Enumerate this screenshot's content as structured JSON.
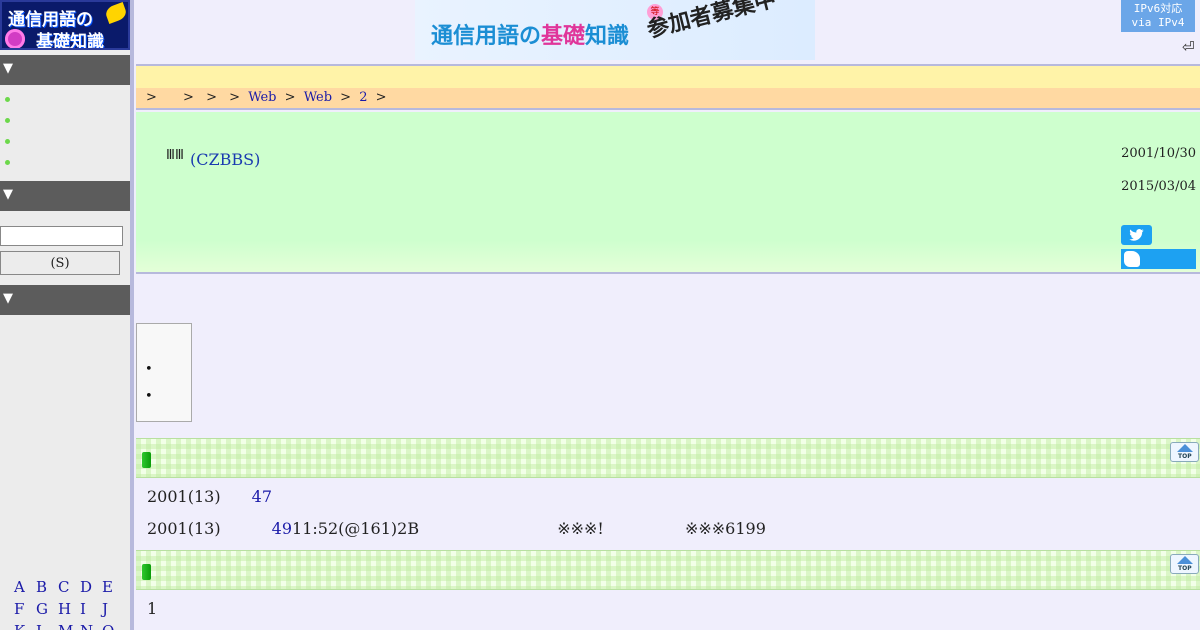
{
  "logo": {
    "line1": "通信用語の",
    "line2": "基礎知識"
  },
  "banner": {
    "title_a": "通信用語の",
    "title_tag": "等",
    "title_b": "基礎",
    "title_c": "知識",
    "cta": "参加者募集中"
  },
  "ipv6_badge": {
    "line1": "IPv6対応",
    "line2": "via IPv4"
  },
  "return_icon": "⏎",
  "sidebar": {
    "head_marker": "▼",
    "search_button_label": "(S)",
    "alphabet": [
      "A",
      "B",
      "C",
      "D",
      "E",
      "F",
      "G",
      "H",
      "I",
      "J",
      "K",
      "L",
      "M",
      "N",
      "O"
    ]
  },
  "breadcrumb": {
    "sep": ">",
    "links": [
      "Web",
      "Web",
      "2"
    ]
  },
  "entry": {
    "icon": "ⅢⅢ",
    "title": "(CZBBS)",
    "date_created": "2001/10/30",
    "date_updated": "2015/03/04"
  },
  "section1": {
    "line1_a": "2001(13)",
    "line1_link": "47",
    "line2_a": "2001(13)",
    "line2_link": "49",
    "line2_b": "11:52(@161)2B",
    "line2_c": "※※※!",
    "line2_d": "※※※6199"
  },
  "section2": {
    "line1": "1"
  },
  "top_label": "TOP"
}
